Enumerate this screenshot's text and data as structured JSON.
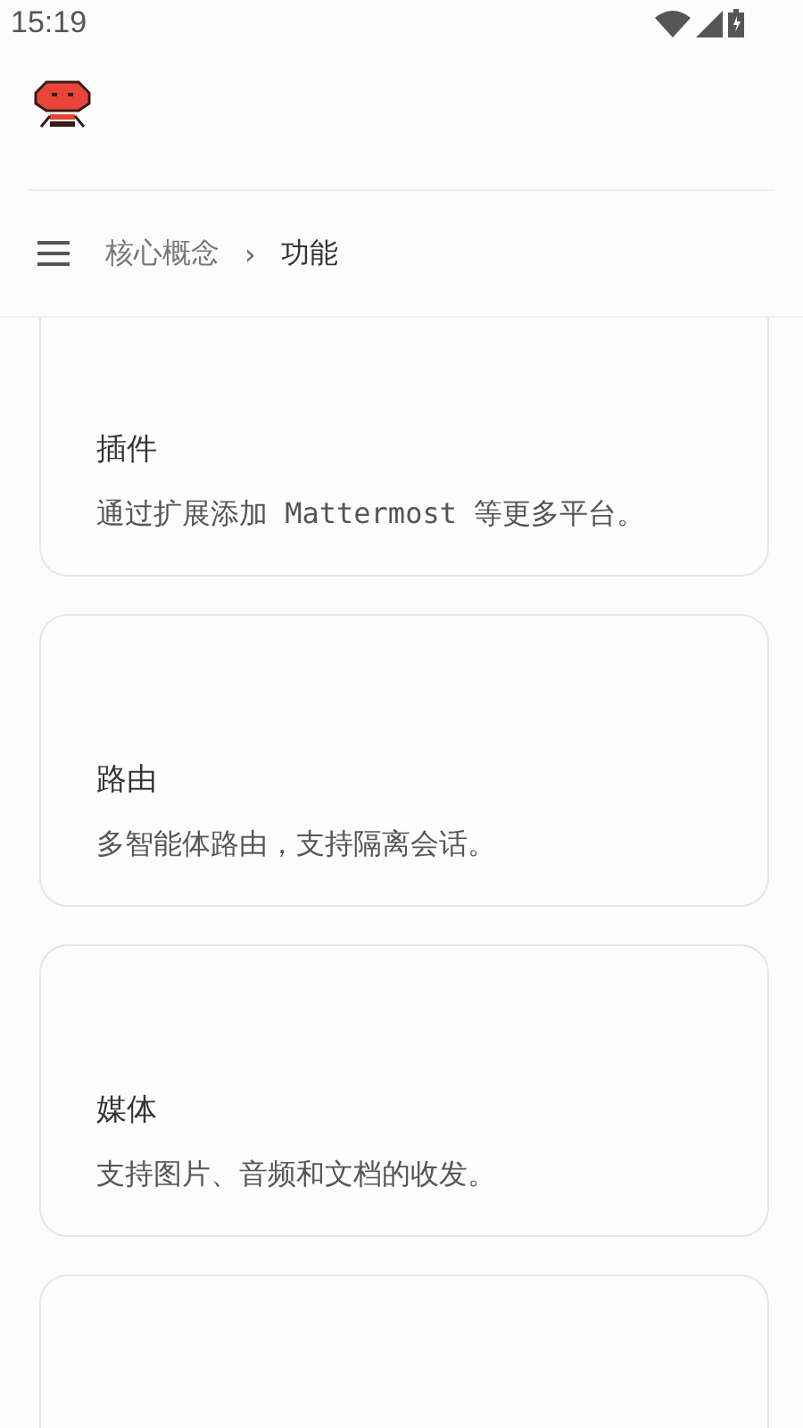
{
  "status_bar": {
    "time": "15:19"
  },
  "breadcrumb": {
    "parent": "核心概念",
    "separator": "›",
    "current": "功能"
  },
  "cards": [
    {
      "title": "插件",
      "description": "通过扩展添加 Mattermost 等更多平台。",
      "clipped": true
    },
    {
      "title": "路由",
      "description": "多智能体路由，支持隔离会话。",
      "clipped": false
    },
    {
      "title": "媒体",
      "description": "支持图片、音频和文档的收发。",
      "clipped": false
    }
  ]
}
